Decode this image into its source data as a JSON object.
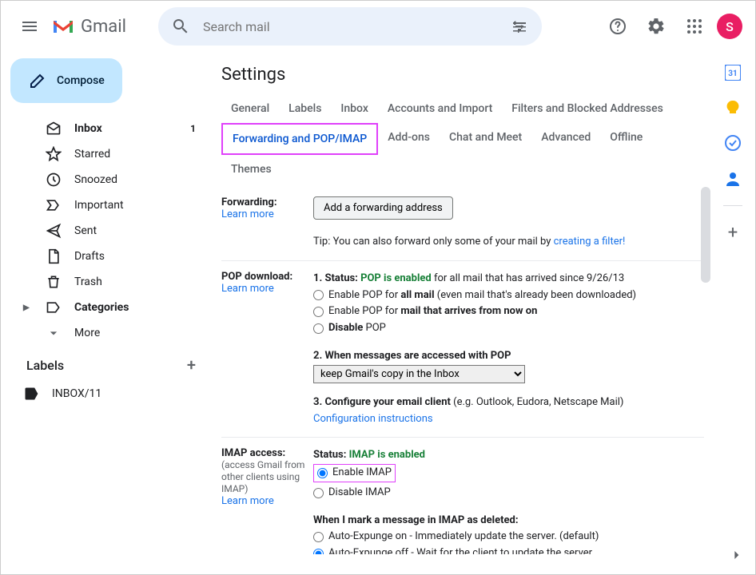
{
  "header": {
    "logo_text": "Gmail",
    "search_placeholder": "Search mail",
    "avatar_letter": "S"
  },
  "compose_label": "Compose",
  "nav": [
    {
      "icon": "inbox",
      "label": "Inbox",
      "count": "1",
      "active": true
    },
    {
      "icon": "star",
      "label": "Starred"
    },
    {
      "icon": "clock",
      "label": "Snoozed"
    },
    {
      "icon": "important",
      "label": "Important"
    },
    {
      "icon": "send",
      "label": "Sent"
    },
    {
      "icon": "draft",
      "label": "Drafts"
    },
    {
      "icon": "trash",
      "label": "Trash"
    },
    {
      "icon": "category",
      "label": "Categories",
      "chev": true,
      "active": true
    },
    {
      "icon": "more",
      "label": "More"
    }
  ],
  "labels_header": "Labels",
  "user_label": "INBOX/11",
  "settings_title": "Settings",
  "tabs": [
    "General",
    "Labels",
    "Inbox",
    "Accounts and Import",
    "Filters and Blocked Addresses",
    "Forwarding and POP/IMAP",
    "Add-ons",
    "Chat and Meet",
    "Advanced",
    "Offline",
    "Themes"
  ],
  "active_tab_index": 5,
  "forwarding": {
    "label": "Forwarding:",
    "learn_more": "Learn more",
    "button": "Add a forwarding address",
    "tip_prefix": "Tip: You can also forward only some of your mail by ",
    "tip_link": "creating a filter!"
  },
  "pop": {
    "label": "POP download:",
    "learn_more": "Learn more",
    "status_prefix": "1. Status: ",
    "status_value": "POP is enabled",
    "status_suffix": " for all mail that has arrived since 9/26/13",
    "opt_all_prefix": "Enable POP for ",
    "opt_all_bold": "all mail",
    "opt_all_suffix": " (even mail that's already been downloaded)",
    "opt_new_prefix": "Enable POP for ",
    "opt_new_bold": "mail that arrives from now on",
    "opt_disable_bold": "Disable",
    "opt_disable_suffix": " POP",
    "q2": "2. When messages are accessed with POP",
    "select_value": "keep Gmail's copy in the Inbox",
    "q3_prefix": "3. Configure your email client",
    "q3_suffix": " (e.g. Outlook, Eudora, Netscape Mail)",
    "config_link": "Configuration instructions"
  },
  "imap": {
    "label": "IMAP access:",
    "sub": "(access Gmail from other clients using IMAP)",
    "learn_more": "Learn more",
    "status_prefix": "Status: ",
    "status_value": "IMAP is enabled",
    "enable": "Enable IMAP",
    "disable": "Disable IMAP",
    "mark_deleted": "When I mark a message in IMAP as deleted:",
    "expunge_on": "Auto-Expunge on - Immediately update the server. (default)",
    "expunge_off": "Auto-Expunge off - Wait for the client to update the server."
  }
}
